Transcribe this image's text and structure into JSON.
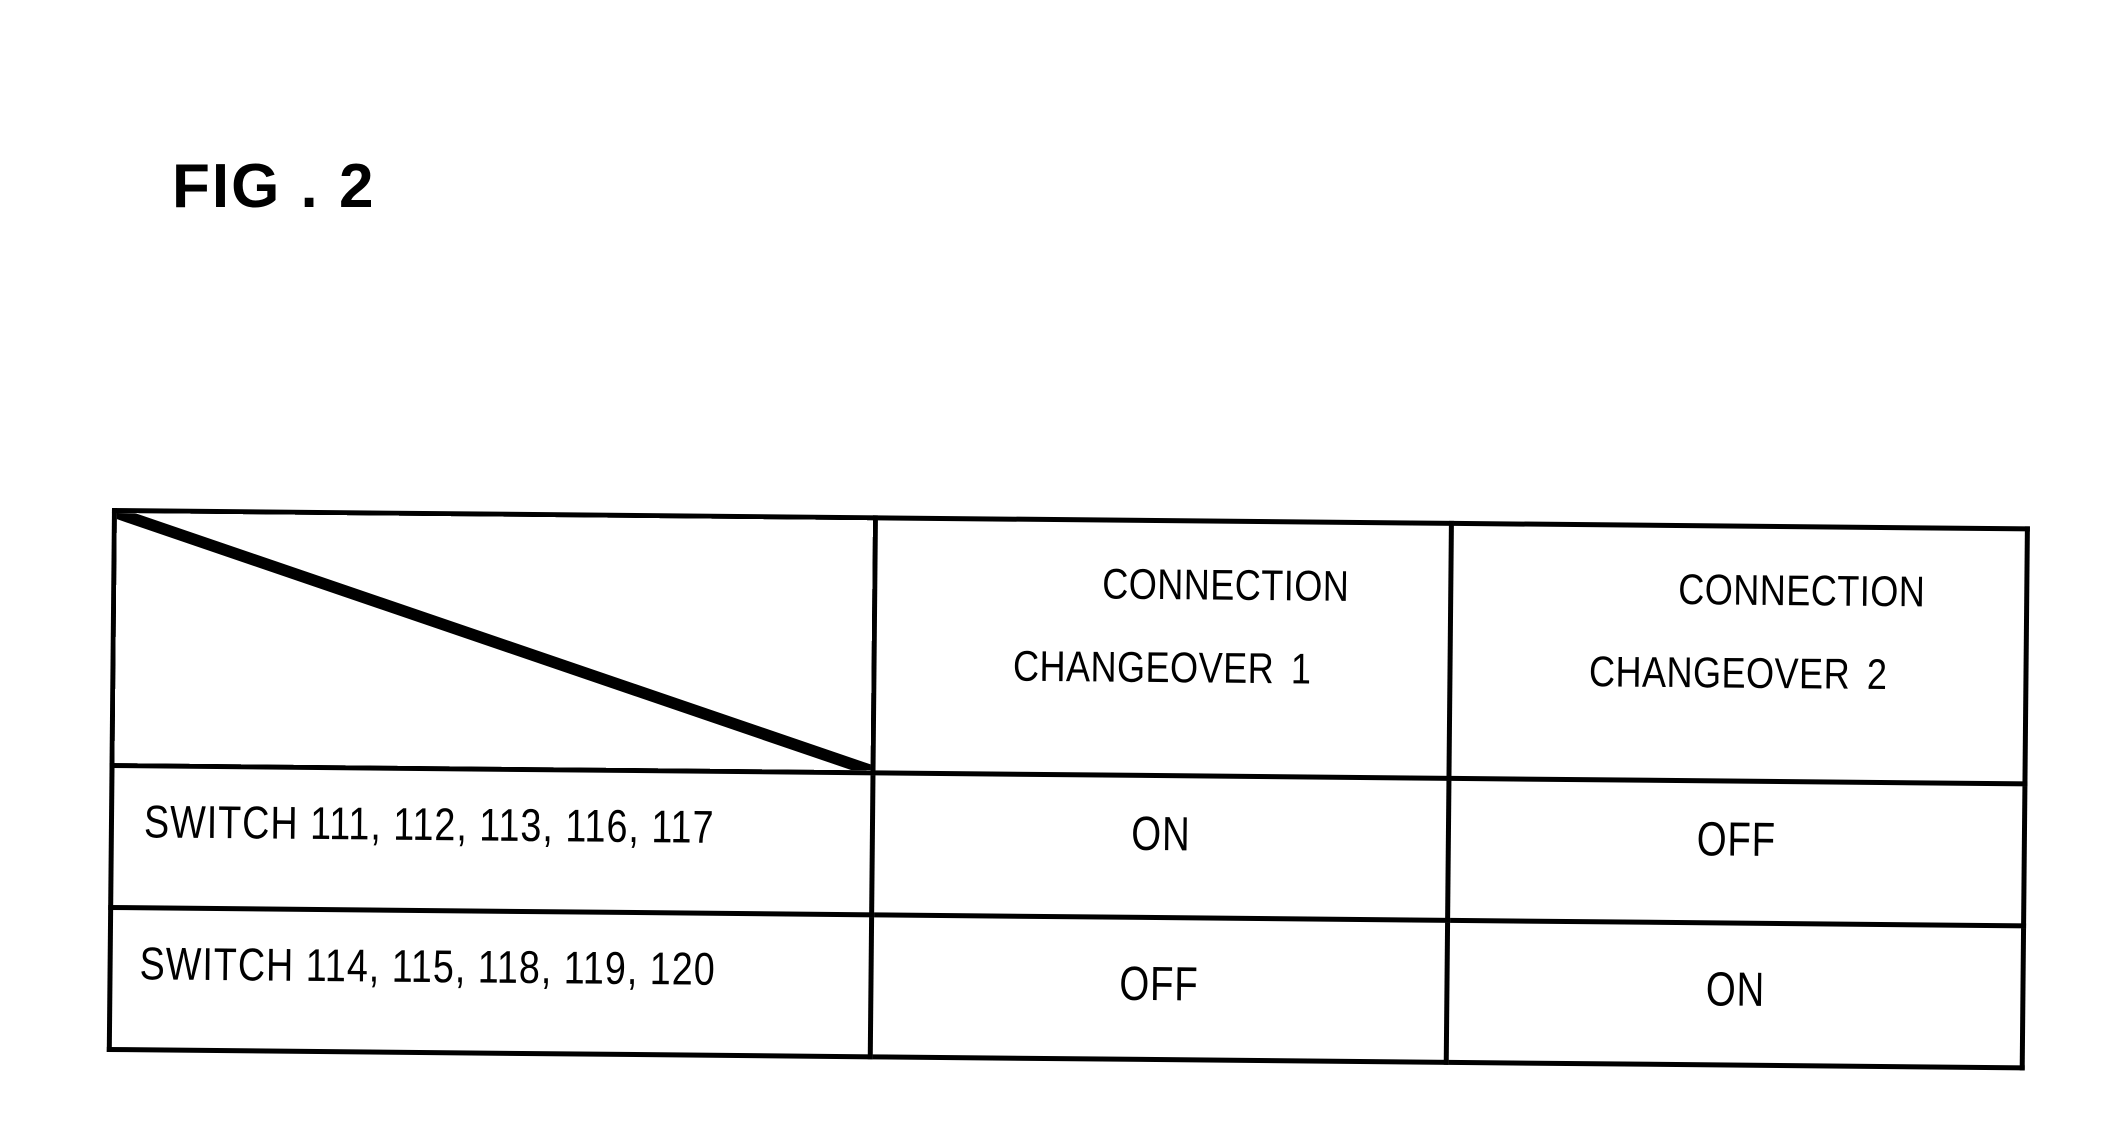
{
  "figure": {
    "title": "FIG . 2",
    "line_color": "#000000",
    "background_color": "#ffffff"
  },
  "table": {
    "corner_cell": {
      "content": "",
      "has_diagonal_divider": true
    },
    "column_headers": [
      {
        "line1": "CONNECTION",
        "line2": "CHANGEOVER",
        "number": "1"
      },
      {
        "line1": "CONNECTION",
        "line2": "CHANGEOVER",
        "number": "2"
      }
    ],
    "rows": [
      {
        "label": "SWITCH 111, 112, 113, 116, 117",
        "values": [
          "ON",
          "OFF"
        ]
      },
      {
        "label": "SWITCH 114, 115, 118, 119, 120",
        "values": [
          "OFF",
          "ON"
        ]
      }
    ]
  }
}
